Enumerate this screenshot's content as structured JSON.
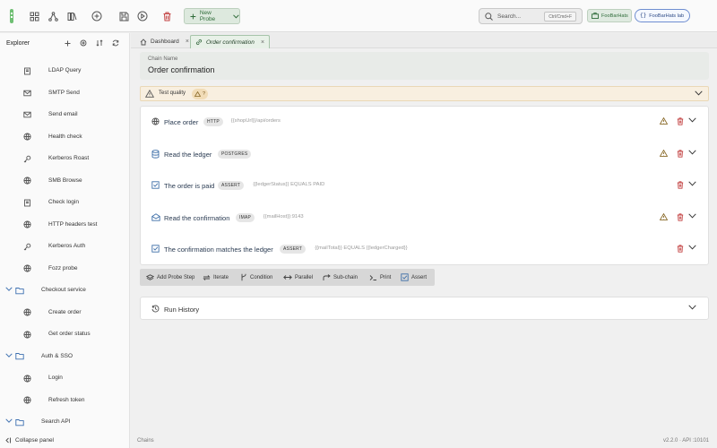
{
  "toolbar": {
    "new_probe_label": "New Probe",
    "search_placeholder": "Search...",
    "search_shortcut": "Ctrl/Cmd+F",
    "workspace_label": "FooBarHats",
    "lab_label": "FooBarHats lab"
  },
  "sidebar": {
    "title": "Explorer",
    "items": [
      {
        "label": "LDAP Query",
        "icon": "book-icon"
      },
      {
        "label": "SMTP Send",
        "icon": "mail-icon"
      },
      {
        "label": "Send email",
        "icon": "mail-icon"
      },
      {
        "label": "Health check",
        "icon": "globe-icon"
      },
      {
        "label": "Kerberos Roast",
        "icon": "key-icon"
      },
      {
        "label": "SMB Browse",
        "icon": "globe-icon"
      },
      {
        "label": "Check login",
        "icon": "book-icon"
      },
      {
        "label": "HTTP headers test",
        "icon": "globe-icon"
      },
      {
        "label": "Kerberos Auth",
        "icon": "key-icon"
      },
      {
        "label": "Fozz probe",
        "icon": "globe-icon"
      },
      {
        "label": "Checkout service",
        "icon": "folder-icon",
        "folder": true
      },
      {
        "label": "Create order",
        "icon": "globe-icon"
      },
      {
        "label": "Get order status",
        "icon": "globe-icon"
      },
      {
        "label": "Auth & SSO",
        "icon": "folder-icon",
        "folder": true
      },
      {
        "label": "Login",
        "icon": "globe-icon"
      },
      {
        "label": "Refresh token",
        "icon": "globe-icon"
      },
      {
        "label": "Search API",
        "icon": "folder-icon",
        "folder": true
      }
    ],
    "collapse_label": "Collapse panel"
  },
  "tabs": [
    {
      "label": "Dashboard",
      "icon": "home-icon"
    },
    {
      "label": "Order confirmation",
      "icon": "link-icon",
      "active": true
    }
  ],
  "chain": {
    "name_label": "Chain Name",
    "name_value": "Order confirmation"
  },
  "quality": {
    "label": "Test quality",
    "badge": "?"
  },
  "steps": [
    {
      "title": "Place order",
      "tag": "HTTP",
      "detail": "{{shopUrl}}/api/orders",
      "icon": "globe-icon",
      "warn": true
    },
    {
      "title": "Read the ledger",
      "tag": "POSTGRES",
      "detail": "",
      "icon": "database-icon",
      "warn": true
    },
    {
      "title": "The order is paid",
      "tag": "ASSERT",
      "detail": "{{ledgerStatus}} EQUALS PAID",
      "icon": "check-square-icon",
      "warn": false
    },
    {
      "title": "Read the confirmation",
      "tag": "IMAP",
      "detail": "{{mailHost}}:9143",
      "icon": "mail-open-icon",
      "warn": true
    },
    {
      "title": "The confirmation matches the ledger",
      "tag": "ASSERT",
      "detail": "{{mailTotal}} EQUALS {{ledgerCharged}}",
      "icon": "check-square-icon",
      "warn": false
    }
  ],
  "actions": [
    {
      "label": "Add Probe Step",
      "icon": "stack-icon"
    },
    {
      "label": "Iterate",
      "icon": "repeat-icon"
    },
    {
      "label": "Condition",
      "icon": "branch-icon"
    },
    {
      "label": "Parallel",
      "icon": "parallel-icon"
    },
    {
      "label": "Sub-chain",
      "icon": "return-icon"
    },
    {
      "label": "Print",
      "icon": "terminal-icon"
    },
    {
      "label": "Assert",
      "icon": "check-square-icon"
    }
  ],
  "run_history": {
    "label": "Run History"
  },
  "status": {
    "left": "Chains",
    "right": "v2.2.0 · API :10101"
  },
  "colors": {
    "accent_green": "#2f6c3a",
    "accent_blue": "#3e6fa8",
    "warning": "#8a6b2a",
    "danger": "#c24040"
  }
}
